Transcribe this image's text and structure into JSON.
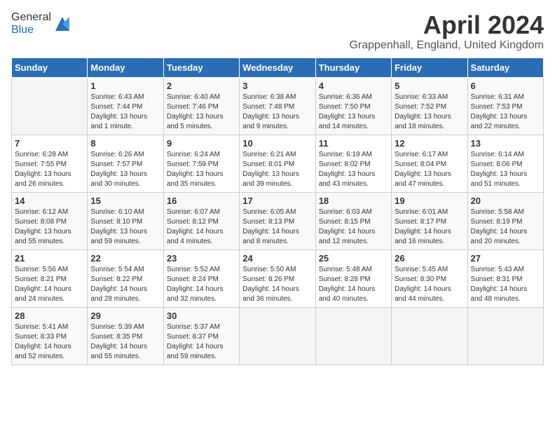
{
  "header": {
    "logo_line1": "General",
    "logo_line2": "Blue",
    "month_title": "April 2024",
    "location": "Grappenhall, England, United Kingdom"
  },
  "days_of_week": [
    "Sunday",
    "Monday",
    "Tuesday",
    "Wednesday",
    "Thursday",
    "Friday",
    "Saturday"
  ],
  "weeks": [
    [
      {
        "num": "",
        "info": ""
      },
      {
        "num": "1",
        "info": "Sunrise: 6:43 AM\nSunset: 7:44 PM\nDaylight: 13 hours\nand 1 minute."
      },
      {
        "num": "2",
        "info": "Sunrise: 6:40 AM\nSunset: 7:46 PM\nDaylight: 13 hours\nand 5 minutes."
      },
      {
        "num": "3",
        "info": "Sunrise: 6:38 AM\nSunset: 7:48 PM\nDaylight: 13 hours\nand 9 minutes."
      },
      {
        "num": "4",
        "info": "Sunrise: 6:36 AM\nSunset: 7:50 PM\nDaylight: 13 hours\nand 14 minutes."
      },
      {
        "num": "5",
        "info": "Sunrise: 6:33 AM\nSunset: 7:52 PM\nDaylight: 13 hours\nand 18 minutes."
      },
      {
        "num": "6",
        "info": "Sunrise: 6:31 AM\nSunset: 7:53 PM\nDaylight: 13 hours\nand 22 minutes."
      }
    ],
    [
      {
        "num": "7",
        "info": "Sunrise: 6:28 AM\nSunset: 7:55 PM\nDaylight: 13 hours\nand 26 minutes."
      },
      {
        "num": "8",
        "info": "Sunrise: 6:26 AM\nSunset: 7:57 PM\nDaylight: 13 hours\nand 30 minutes."
      },
      {
        "num": "9",
        "info": "Sunrise: 6:24 AM\nSunset: 7:59 PM\nDaylight: 13 hours\nand 35 minutes."
      },
      {
        "num": "10",
        "info": "Sunrise: 6:21 AM\nSunset: 8:01 PM\nDaylight: 13 hours\nand 39 minutes."
      },
      {
        "num": "11",
        "info": "Sunrise: 6:19 AM\nSunset: 8:02 PM\nDaylight: 13 hours\nand 43 minutes."
      },
      {
        "num": "12",
        "info": "Sunrise: 6:17 AM\nSunset: 8:04 PM\nDaylight: 13 hours\nand 47 minutes."
      },
      {
        "num": "13",
        "info": "Sunrise: 6:14 AM\nSunset: 8:06 PM\nDaylight: 13 hours\nand 51 minutes."
      }
    ],
    [
      {
        "num": "14",
        "info": "Sunrise: 6:12 AM\nSunset: 8:08 PM\nDaylight: 13 hours\nand 55 minutes."
      },
      {
        "num": "15",
        "info": "Sunrise: 6:10 AM\nSunset: 8:10 PM\nDaylight: 13 hours\nand 59 minutes."
      },
      {
        "num": "16",
        "info": "Sunrise: 6:07 AM\nSunset: 8:12 PM\nDaylight: 14 hours\nand 4 minutes."
      },
      {
        "num": "17",
        "info": "Sunrise: 6:05 AM\nSunset: 8:13 PM\nDaylight: 14 hours\nand 8 minutes."
      },
      {
        "num": "18",
        "info": "Sunrise: 6:03 AM\nSunset: 8:15 PM\nDaylight: 14 hours\nand 12 minutes."
      },
      {
        "num": "19",
        "info": "Sunrise: 6:01 AM\nSunset: 8:17 PM\nDaylight: 14 hours\nand 16 minutes."
      },
      {
        "num": "20",
        "info": "Sunrise: 5:58 AM\nSunset: 8:19 PM\nDaylight: 14 hours\nand 20 minutes."
      }
    ],
    [
      {
        "num": "21",
        "info": "Sunrise: 5:56 AM\nSunset: 8:21 PM\nDaylight: 14 hours\nand 24 minutes."
      },
      {
        "num": "22",
        "info": "Sunrise: 5:54 AM\nSunset: 8:22 PM\nDaylight: 14 hours\nand 28 minutes."
      },
      {
        "num": "23",
        "info": "Sunrise: 5:52 AM\nSunset: 8:24 PM\nDaylight: 14 hours\nand 32 minutes."
      },
      {
        "num": "24",
        "info": "Sunrise: 5:50 AM\nSunset: 8:26 PM\nDaylight: 14 hours\nand 36 minutes."
      },
      {
        "num": "25",
        "info": "Sunrise: 5:48 AM\nSunset: 8:28 PM\nDaylight: 14 hours\nand 40 minutes."
      },
      {
        "num": "26",
        "info": "Sunrise: 5:45 AM\nSunset: 8:30 PM\nDaylight: 14 hours\nand 44 minutes."
      },
      {
        "num": "27",
        "info": "Sunrise: 5:43 AM\nSunset: 8:31 PM\nDaylight: 14 hours\nand 48 minutes."
      }
    ],
    [
      {
        "num": "28",
        "info": "Sunrise: 5:41 AM\nSunset: 8:33 PM\nDaylight: 14 hours\nand 52 minutes."
      },
      {
        "num": "29",
        "info": "Sunrise: 5:39 AM\nSunset: 8:35 PM\nDaylight: 14 hours\nand 55 minutes."
      },
      {
        "num": "30",
        "info": "Sunrise: 5:37 AM\nSunset: 8:37 PM\nDaylight: 14 hours\nand 59 minutes."
      },
      {
        "num": "",
        "info": ""
      },
      {
        "num": "",
        "info": ""
      },
      {
        "num": "",
        "info": ""
      },
      {
        "num": "",
        "info": ""
      }
    ]
  ]
}
